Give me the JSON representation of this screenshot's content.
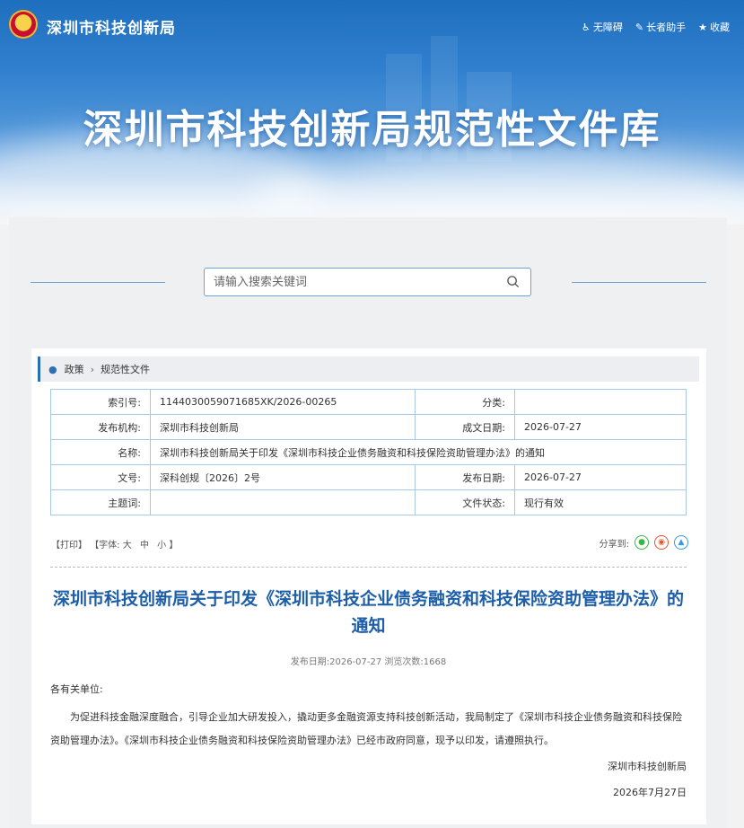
{
  "header": {
    "site_name": "深圳市科技创新局",
    "top_links": [
      {
        "label": "无障碍",
        "icon": "accessibility-icon"
      },
      {
        "label": "长者助手",
        "icon": "elder-assist-icon"
      },
      {
        "label": "收藏",
        "icon": "star-icon"
      }
    ],
    "banner_title": "深圳市科技创新局规范性文件库"
  },
  "search": {
    "placeholder": "请输入搜索关键词",
    "value": ""
  },
  "breadcrumb": {
    "items": [
      "政策",
      "规范性文件"
    ]
  },
  "meta_table": {
    "index_no_label": "索引号:",
    "index_no": "1144030059071685XK/2026-00265",
    "category_label": "分类:",
    "category": "",
    "publisher_label": "发布机构:",
    "publisher": "深圳市科技创新局",
    "created_label": "成文日期:",
    "created": "2026-07-27",
    "name_label": "名称:",
    "name": "深圳市科技创新局关于印发《深圳市科技企业债务融资和科技保险资助管理办法》的通知",
    "doc_no_label": "文号:",
    "doc_no": "深科创规〔2026〕2号",
    "published_label": "发布日期:",
    "published": "2026-07-27",
    "subject_label": "主题词:",
    "subject": "",
    "status_label": "文件状态:",
    "status": "现行有效"
  },
  "tools": {
    "print": "【打印】",
    "font_prefix": "【字体:",
    "font_large": "大",
    "font_medium": "中",
    "font_small": "小",
    "font_suffix": "】",
    "share_label": "分享到:"
  },
  "article": {
    "title": "深圳市科技创新局关于印发《深圳市科技企业债务融资和科技保险资助管理办法》的通知",
    "meta": "发布日期:2026-07-27  浏览次数:1668",
    "salutation": "各有关单位:",
    "paragraph": "为促进科技金融深度融合，引导企业加大研发投入，撬动更多金融资源支持科技创新活动，我局制定了《深圳市科技企业债务融资和科技保险资助管理办法》。《深圳市科技企业债务融资和科技保险资助管理办法》已经市政府同意，现予以印发，请遵照执行。",
    "signature": "深圳市科技创新局",
    "date": "2026年7月27日"
  },
  "colors": {
    "accent": "#1c5ea8",
    "border": "#a9c8e6",
    "banner": "#2f7fce"
  }
}
